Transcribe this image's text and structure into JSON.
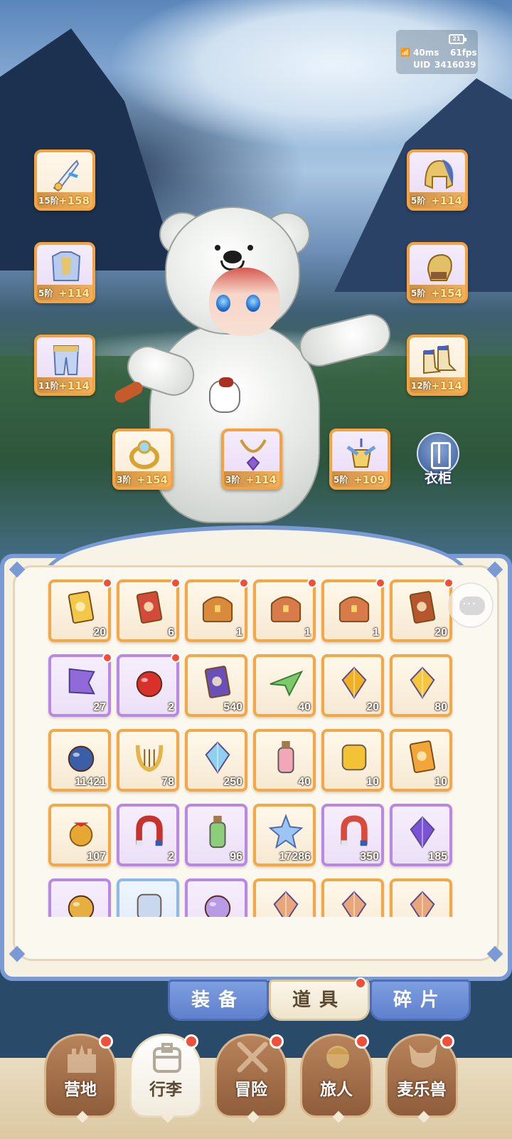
{
  "hud": {
    "battery": "21",
    "ping": "40ms",
    "fps": "61fps",
    "uid_label": "UID",
    "uid_value": "3416039"
  },
  "equipment": [
    {
      "name": "weapon",
      "tier": "15阶",
      "bonus": "+158",
      "icon": "sword-icon"
    },
    {
      "name": "helmet",
      "tier": "5阶",
      "bonus": "+114",
      "icon": "helmet-icon"
    },
    {
      "name": "chest",
      "tier": "5阶",
      "bonus": "+114",
      "icon": "armor-chest-icon"
    },
    {
      "name": "gloves",
      "tier": "5阶",
      "bonus": "+154",
      "icon": "gauntlet-icon"
    },
    {
      "name": "legs",
      "tier": "11阶",
      "bonus": "+114",
      "icon": "leg-armor-icon"
    },
    {
      "name": "boots",
      "tier": "12阶",
      "bonus": "+114",
      "icon": "boots-icon"
    },
    {
      "name": "ring",
      "tier": "3阶",
      "bonus": "+154",
      "icon": "ring-icon"
    },
    {
      "name": "necklace",
      "tier": "3阶",
      "bonus": "+114",
      "icon": "necklace-icon"
    },
    {
      "name": "charm",
      "tier": "5阶",
      "bonus": "+109",
      "icon": "charm-icon"
    }
  ],
  "wardrobe": {
    "label": "衣柜",
    "icon": "wardrobe-icon"
  },
  "inventory": [
    {
      "icon": "gold-card-icon",
      "count": "20",
      "rarity": "orange",
      "new": true
    },
    {
      "icon": "red-card-icon",
      "count": "6",
      "rarity": "orange",
      "new": true
    },
    {
      "icon": "treasure-chest-icon",
      "count": "1",
      "rarity": "orange",
      "new": true
    },
    {
      "icon": "ornate-chest-icon",
      "count": "1",
      "rarity": "orange",
      "new": true
    },
    {
      "icon": "ornate-chest-icon",
      "count": "1",
      "rarity": "orange",
      "new": true
    },
    {
      "icon": "card-pack-icon",
      "count": "20",
      "rarity": "orange",
      "new": true
    },
    {
      "icon": "purple-flag-icon",
      "count": "27",
      "rarity": "purple",
      "new": true
    },
    {
      "icon": "apple-icon",
      "count": "2",
      "rarity": "purple",
      "new": true
    },
    {
      "icon": "purple-ticket-icon",
      "count": "540",
      "rarity": "orange",
      "new": false
    },
    {
      "icon": "paper-plane-icon",
      "count": "40",
      "rarity": "orange",
      "new": false
    },
    {
      "icon": "gold-crystal-icon",
      "count": "20",
      "rarity": "orange",
      "new": false
    },
    {
      "icon": "gold-star-shard-icon",
      "count": "80",
      "rarity": "orange",
      "new": false
    },
    {
      "icon": "cat-orb-icon",
      "count": "11421",
      "rarity": "orange",
      "new": false
    },
    {
      "icon": "lyre-icon",
      "count": "78",
      "rarity": "orange",
      "new": false
    },
    {
      "icon": "blue-crystal-icon",
      "count": "250",
      "rarity": "orange",
      "new": false
    },
    {
      "icon": "paint-tube-icon",
      "count": "40",
      "rarity": "orange",
      "new": false
    },
    {
      "icon": "paint-splash-icon",
      "count": "10",
      "rarity": "orange",
      "new": false
    },
    {
      "icon": "pet-card-icon",
      "count": "10",
      "rarity": "orange",
      "new": false
    },
    {
      "icon": "bell-icon",
      "count": "107",
      "rarity": "orange",
      "new": false
    },
    {
      "icon": "horseshoe-icon",
      "count": "2",
      "rarity": "purple",
      "new": false
    },
    {
      "icon": "potion-bottle-icon",
      "count": "96",
      "rarity": "purple",
      "new": false
    },
    {
      "icon": "blue-star-icon",
      "count": "17286",
      "rarity": "orange",
      "new": false
    },
    {
      "icon": "magnet-icon",
      "count": "350",
      "rarity": "purple",
      "new": false
    },
    {
      "icon": "purple-gem-icon",
      "count": "185",
      "rarity": "purple",
      "new": false
    },
    {
      "icon": "gold-egg-icon",
      "count": "",
      "rarity": "purple",
      "new": false
    },
    {
      "icon": "blue-item-icon",
      "count": "",
      "rarity": "blue",
      "new": false
    },
    {
      "icon": "purple-orb-icon",
      "count": "",
      "rarity": "purple",
      "new": false
    },
    {
      "icon": "shard-icon",
      "count": "",
      "rarity": "orange",
      "new": false
    },
    {
      "icon": "shard-icon",
      "count": "",
      "rarity": "orange",
      "new": false
    },
    {
      "icon": "shard-icon",
      "count": "",
      "rarity": "orange",
      "new": false
    }
  ],
  "tabs": [
    {
      "label": "装备",
      "active": false,
      "new": false
    },
    {
      "label": "道具",
      "active": true,
      "new": true
    },
    {
      "label": "碎片",
      "active": false,
      "new": false
    }
  ],
  "nav": [
    {
      "label": "营地",
      "icon": "castle-icon",
      "active": false
    },
    {
      "label": "行李",
      "icon": "backpack-icon",
      "active": true
    },
    {
      "label": "冒险",
      "icon": "crossed-swords-icon",
      "active": false
    },
    {
      "label": "旅人",
      "icon": "traveler-icon",
      "active": false
    },
    {
      "label": "麦乐兽",
      "icon": "beast-icon",
      "active": false
    }
  ],
  "colors": {
    "orange_frame": "#f3a847",
    "purple_frame": "#b888e6",
    "panel_blue": "#7a9ad6",
    "badge_red": "#f0503a"
  }
}
